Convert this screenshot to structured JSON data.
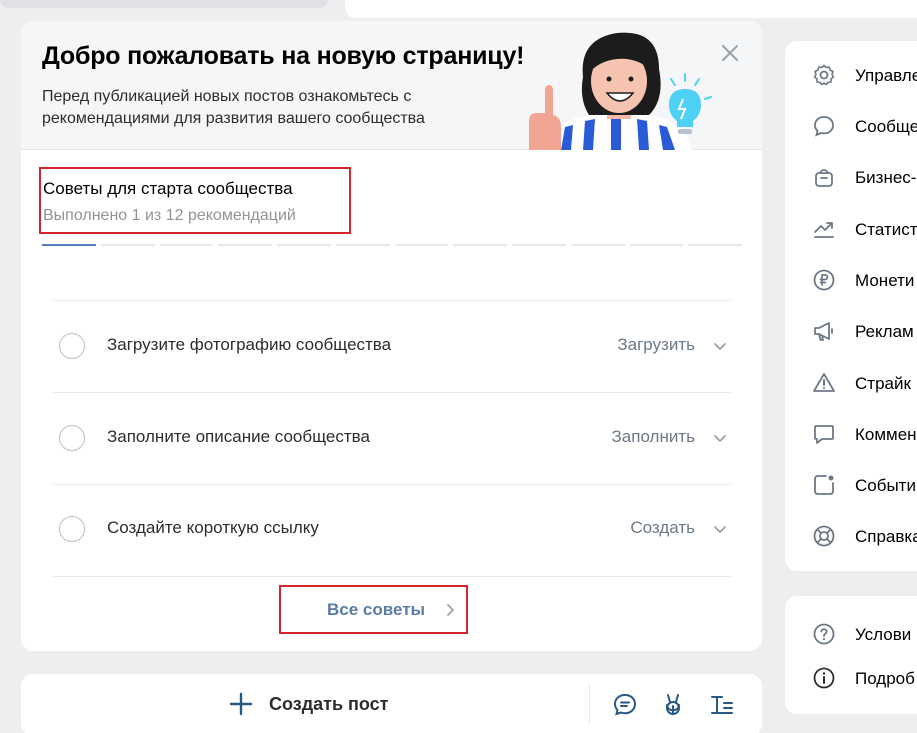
{
  "banner": {
    "title": "Добро пожаловать на новую страницу!",
    "subtitle": "Перед публикацией новых постов ознакомьтесь с рекомендациями для развития вашего сообщества"
  },
  "progress": {
    "title": "Советы для старта сообщества",
    "subtitle": "Выполнено 1 из 12 рекомендаций",
    "completed": 1,
    "total": 12
  },
  "tasks": [
    {
      "label": "Загрузите фотографию сообщества",
      "action": "Загрузить"
    },
    {
      "label": "Заполните описание сообщества",
      "action": "Заполнить"
    },
    {
      "label": "Создайте короткую ссылку",
      "action": "Создать"
    }
  ],
  "all_tips": {
    "label": "Все советы"
  },
  "post_bar": {
    "create_label": "Создать пост"
  },
  "sidebar": {
    "items": [
      {
        "label": "Управле",
        "icon": "gear-icon"
      },
      {
        "label": "Сообще",
        "icon": "message-bubble-icon"
      },
      {
        "label": "Бизнес-",
        "icon": "shopping-bag-icon"
      },
      {
        "label": "Статист",
        "icon": "trending-chart-icon"
      },
      {
        "label": "Монети",
        "icon": "ruble-coin-icon"
      },
      {
        "label": "Реклам",
        "icon": "megaphone-icon"
      },
      {
        "label": "Страйк",
        "icon": "warning-triangle-icon"
      },
      {
        "label": "Коммен",
        "icon": "comment-icon"
      },
      {
        "label": "Событи",
        "icon": "event-notification-icon"
      },
      {
        "label": "Справка",
        "icon": "lifebuoy-icon"
      }
    ]
  },
  "sidebar2": {
    "items": [
      {
        "label": "Услови",
        "icon": "question-circle-icon"
      },
      {
        "label": "Подроб",
        "icon": "info-circle-icon"
      }
    ]
  },
  "colors": {
    "accent": "#5181b8",
    "link": "#5a7ca6",
    "highlight_border": "#d2272e",
    "background": "#edeef0"
  }
}
